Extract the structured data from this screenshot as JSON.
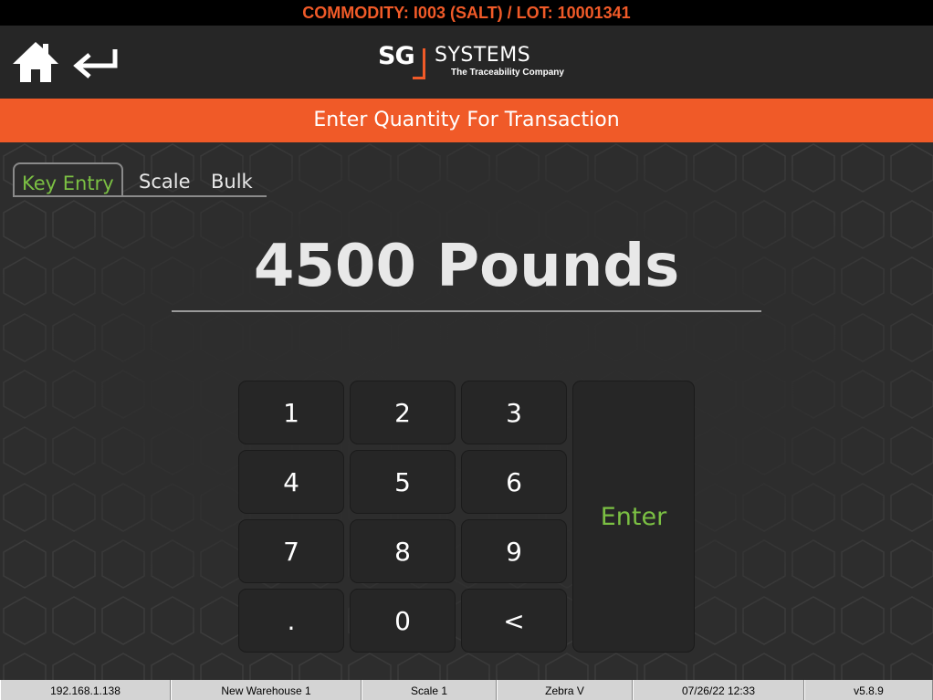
{
  "banner": {
    "text": "COMMODITY: I003 (SALT) / LOT: 10001341"
  },
  "header": {
    "logo": {
      "sg": "SG",
      "systems": "SYSTEMS",
      "tagline": "The Traceability Company"
    }
  },
  "title": "Enter Quantity For Transaction",
  "tabs": [
    {
      "label": "Key Entry",
      "active": true
    },
    {
      "label": "Scale",
      "active": false
    },
    {
      "label": "Bulk",
      "active": false
    }
  ],
  "quantity": {
    "display": "4500 Pounds"
  },
  "keypad": {
    "keys": [
      "1",
      "2",
      "3",
      "4",
      "5",
      "6",
      "7",
      "8",
      "9",
      ".",
      "0",
      "<"
    ],
    "enter_label": "Enter"
  },
  "status": {
    "ip": "192.168.1.138",
    "warehouse": "New Warehouse 1",
    "scale": "Scale 1",
    "printer": "Zebra V",
    "datetime": "07/26/22 12:33",
    "version": "v5.8.9"
  },
  "colors": {
    "accent": "#f05a28",
    "active": "#7bc043",
    "background": "#2d2d2d"
  },
  "icons": {
    "home": "home-icon",
    "back": "return-arrow-icon"
  }
}
